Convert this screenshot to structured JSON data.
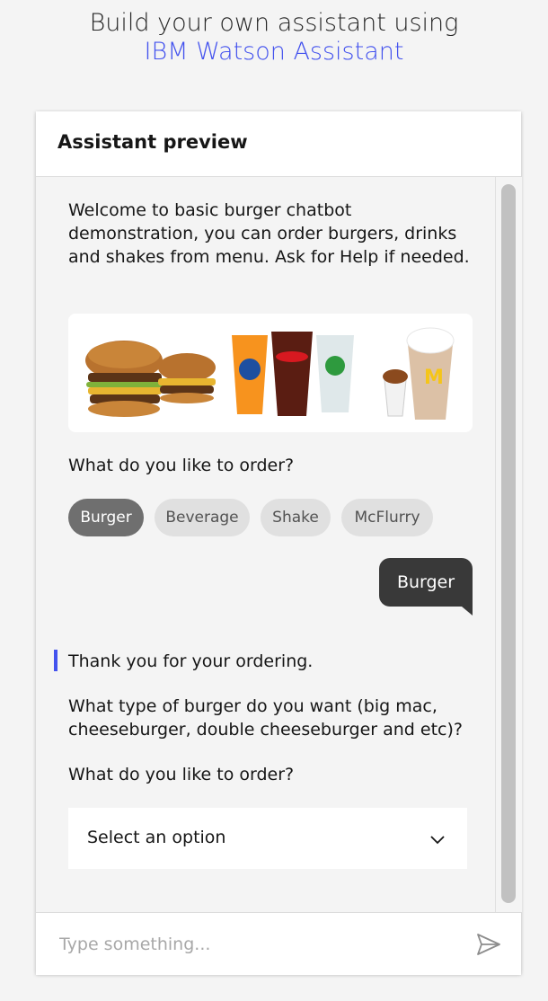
{
  "hero": {
    "line1": "Build your own assistant using",
    "link": "IBM Watson Assistant"
  },
  "panel": {
    "title": "Assistant preview"
  },
  "chat": {
    "welcome": "Welcome to basic burger chatbot demonstration, you can order burgers, drinks and shakes from menu. Ask for Help if needed.",
    "menu_image_icon": "menu-food-image",
    "prompt1": "What do you like to order?",
    "options": [
      {
        "label": "Burger",
        "selected": true
      },
      {
        "label": "Beverage",
        "selected": false
      },
      {
        "label": "Shake",
        "selected": false
      },
      {
        "label": "McFlurry",
        "selected": false
      }
    ],
    "user_message": "Burger",
    "reply1": "Thank you for your ordering.",
    "reply2": "What type of burger do you want (big mac, cheeseburger, double cheeseburger and etc)?",
    "prompt2": "What do you like to order?",
    "select_value": "Select an option"
  },
  "composer": {
    "placeholder": "Type something...",
    "send_icon": "send-icon"
  },
  "colors": {
    "accent": "#4352ee",
    "user_bubble": "#393939",
    "chip_selected": "#6f6f6f",
    "chip": "#e0e0e0",
    "background": "#f4f4f4"
  }
}
